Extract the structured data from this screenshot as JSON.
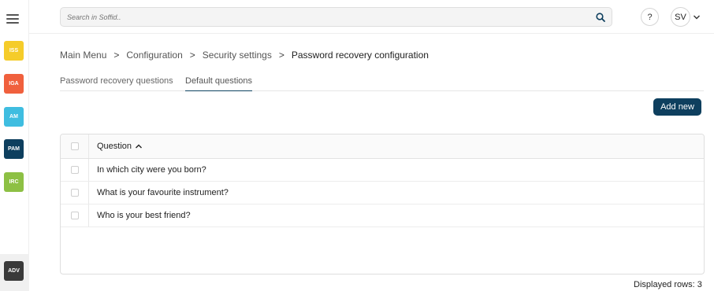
{
  "search": {
    "placeholder": "Search in Soffid.."
  },
  "header": {
    "help_label": "?",
    "user_initials": "SV"
  },
  "modules": [
    {
      "label": "ISS",
      "color": "#f5cc2a"
    },
    {
      "label": "IGA",
      "color": "#f0603d"
    },
    {
      "label": "AM",
      "color": "#3fbde0"
    },
    {
      "label": "PAM",
      "color": "#0e3f5e"
    },
    {
      "label": "IRC",
      "color": "#8dc044"
    },
    {
      "label": "ADV",
      "color": "#3a3a3a"
    }
  ],
  "breadcrumb": {
    "items": [
      "Main Menu",
      "Configuration",
      "Security settings"
    ],
    "current": "Password recovery configuration",
    "separator": ">"
  },
  "tabs": [
    {
      "label": "Password recovery questions",
      "active": false
    },
    {
      "label": "Default questions",
      "active": true
    }
  ],
  "toolbar": {
    "add_new_label": "Add new"
  },
  "table": {
    "column_header": "Question",
    "sort": "ascending",
    "rows": [
      "In which city were you born?",
      "What is your favourite instrument?",
      "Who is your best friend?"
    ]
  },
  "footer": {
    "displayed_rows": "Displayed rows: 3"
  }
}
